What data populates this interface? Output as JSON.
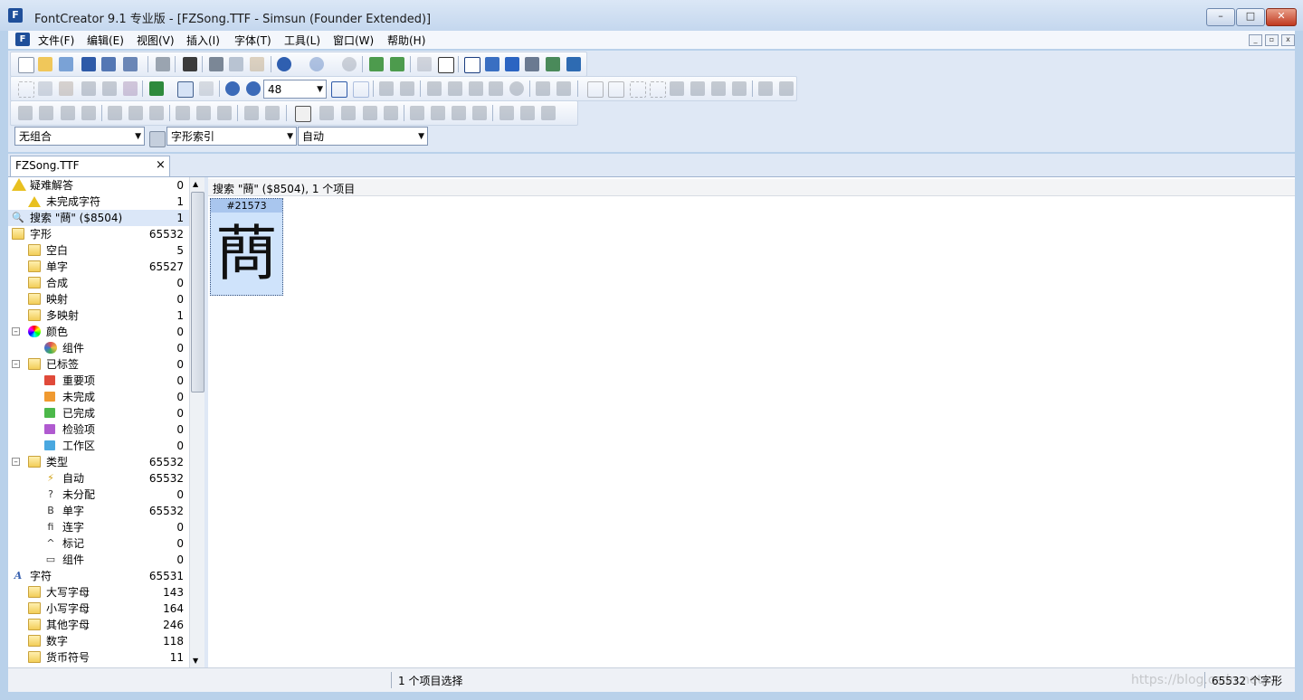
{
  "window": {
    "title": "FontCreator 9.1 专业版  - [FZSong.TTF - Simsun (Founder Extended)]",
    "app_icon": "F",
    "buttons": {
      "minimize": "–",
      "maximize": "□",
      "close": "✕"
    }
  },
  "menu": {
    "items": [
      "文件(F)",
      "编辑(E)",
      "视图(V)",
      "插入(I)",
      "字体(T)",
      "工具(L)",
      "窗口(W)",
      "帮助(H)"
    ],
    "mdi_buttons": [
      "_",
      "▫",
      "x"
    ]
  },
  "toolbar": {
    "zoom_value": "48",
    "combo_group": "无组合",
    "combo_index": "字形索引",
    "combo_mode": "自动"
  },
  "tab": {
    "label": "FZSong.TTF",
    "close": "×"
  },
  "tree": {
    "items": [
      {
        "label": "疑难解答",
        "count": "0",
        "icon": "warning-icon"
      },
      {
        "label": "未完成字符",
        "count": "1",
        "icon": "warning-icon"
      },
      {
        "label": "搜索 \"蔄\" ($8504)",
        "count": "1",
        "icon": "search-icon"
      },
      {
        "label": "字形",
        "count": "65532",
        "icon": "folder-icon"
      },
      {
        "label": "空白",
        "count": "5",
        "icon": "folder-icon"
      },
      {
        "label": "单字",
        "count": "65527",
        "icon": "folder-icon"
      },
      {
        "label": "合成",
        "count": "0",
        "icon": "folder-icon"
      },
      {
        "label": "映射",
        "count": "0",
        "icon": "folder-icon"
      },
      {
        "label": "多映射",
        "count": "1",
        "icon": "folder-icon"
      },
      {
        "label": "颜色",
        "count": "0",
        "icon": "color-wheel-icon",
        "expander": "–"
      },
      {
        "label": "组件",
        "count": "0",
        "icon": "color-component-icon"
      },
      {
        "label": "已标签",
        "count": "0",
        "icon": "folder-icon",
        "expander": "–"
      },
      {
        "label": "重要项",
        "count": "0",
        "icon": "red-flag-icon"
      },
      {
        "label": "未完成",
        "count": "0",
        "icon": "orange-flag-icon"
      },
      {
        "label": "已完成",
        "count": "0",
        "icon": "green-flag-icon"
      },
      {
        "label": "检验项",
        "count": "0",
        "icon": "purple-flag-icon"
      },
      {
        "label": "工作区",
        "count": "0",
        "icon": "blue-flag-icon"
      },
      {
        "label": "类型",
        "count": "65532",
        "icon": "folder-icon",
        "expander": "–"
      },
      {
        "label": "自动",
        "count": "65532",
        "icon": "lightning-icon",
        "glyph": "⚡"
      },
      {
        "label": "未分配",
        "count": "0",
        "icon": "question-icon",
        "glyph": "?"
      },
      {
        "label": "单字",
        "count": "65532",
        "icon": "simple-glyph-icon",
        "glyph": "B"
      },
      {
        "label": "连字",
        "count": "0",
        "icon": "ligature-icon",
        "glyph": "fi"
      },
      {
        "label": "标记",
        "count": "0",
        "icon": "mark-icon",
        "glyph": "^"
      },
      {
        "label": "组件",
        "count": "0",
        "icon": "component-icon",
        "glyph": "▭"
      },
      {
        "label": "字符",
        "count": "65531",
        "icon": "character-icon",
        "glyph": "A"
      },
      {
        "label": "大写字母",
        "count": "143",
        "icon": "folder-icon"
      },
      {
        "label": "小写字母",
        "count": "164",
        "icon": "folder-icon"
      },
      {
        "label": "其他字母",
        "count": "246",
        "icon": "folder-icon"
      },
      {
        "label": "数字",
        "count": "118",
        "icon": "folder-icon"
      },
      {
        "label": "货币符号",
        "count": "11",
        "icon": "folder-icon"
      }
    ]
  },
  "main": {
    "header": "搜索 \"蔄\" ($8504), 1 个项目",
    "glyph_index": "#21573",
    "glyph_char": "蔄"
  },
  "status": {
    "selection": "1 个项目选择",
    "glyph_count": "65532 个字形"
  },
  "watermark": "https://blog.csdn.net/..."
}
